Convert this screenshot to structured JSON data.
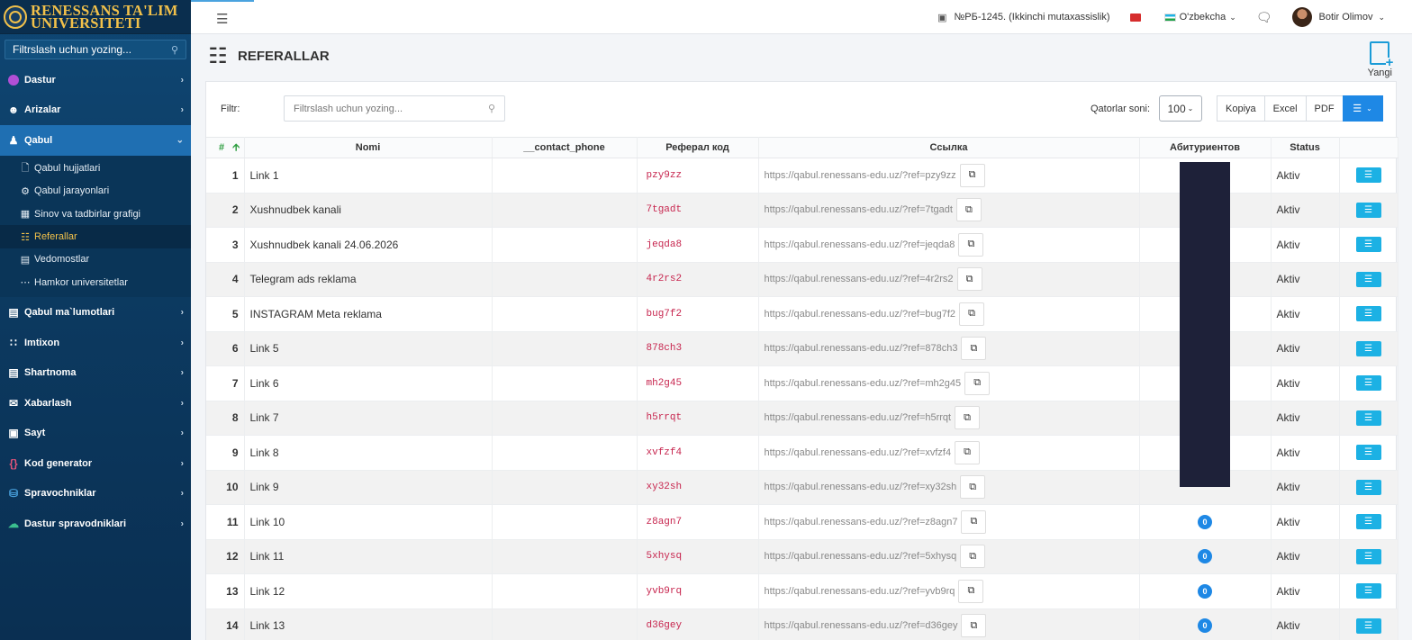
{
  "brand": {
    "line1": "RENESSANS TA'LIM",
    "line2": "UNIVERSITETI"
  },
  "sidebar": {
    "search_placeholder": "Filtrslash uchun yozing...",
    "items": [
      {
        "label": "Dastur",
        "icon": "info-circle-icon"
      },
      {
        "label": "Arizalar",
        "icon": "user-tie-icon"
      },
      {
        "label": "Qabul",
        "icon": "user-icon"
      },
      {
        "label": "Qabul ma`lumotlari",
        "icon": "clipboard-icon"
      },
      {
        "label": "Imtixon",
        "icon": "grid-dots-icon"
      },
      {
        "label": "Shartnoma",
        "icon": "document-icon"
      },
      {
        "label": "Xabarlash",
        "icon": "envelope-icon"
      },
      {
        "label": "Sayt",
        "icon": "window-icon"
      },
      {
        "label": "Kod generator",
        "icon": "code-braces-icon"
      },
      {
        "label": "Spravochniklar",
        "icon": "database-icon"
      },
      {
        "label": "Dastur spravodniklari",
        "icon": "cloud-icon"
      }
    ],
    "sub_items": [
      {
        "label": "Qabul hujjatlari",
        "icon": "file-icon"
      },
      {
        "label": "Qabul jarayonlari",
        "icon": "gear-icon"
      },
      {
        "label": "Sinov va tadbirlar grafigi",
        "icon": "calendar-icon"
      },
      {
        "label": "Referallar",
        "icon": "sitemap-icon"
      },
      {
        "label": "Vedomostlar",
        "icon": "list-icon"
      },
      {
        "label": "Hamkor universitetlar",
        "icon": "ellipsis-icon"
      }
    ]
  },
  "topbar": {
    "position": "№РБ-1245. (Ikkinchi mutaxassislik)",
    "language": "O'zbekcha",
    "user": "Botir Olimov"
  },
  "page": {
    "title": "REFERALLAR",
    "new_label": "Yangi"
  },
  "toolbar": {
    "filter_label": "Filtr:",
    "filter_placeholder": "Filtrslash uchun yozing...",
    "rows_label": "Qatorlar soni:",
    "rows_value": "100",
    "btn_copy": "Kopiya",
    "btn_excel": "Excel",
    "btn_pdf": "PDF"
  },
  "table": {
    "headers": {
      "num": "#",
      "name": "Nomi",
      "phone": "__contact_phone",
      "code": "Реферал код",
      "link": "Ссылка",
      "count": "Абитуриентов",
      "status": "Status"
    },
    "rows": [
      {
        "n": "1",
        "name": "Link 1",
        "code": "pzy9zz",
        "link": "https://qabul.renessans-edu.uz/?ref=pzy9zz",
        "count": "",
        "status": "Aktiv"
      },
      {
        "n": "2",
        "name": "Xushnudbek kanali",
        "code": "7tgadt",
        "link": "https://qabul.renessans-edu.uz/?ref=7tgadt",
        "count": "",
        "status": "Aktiv"
      },
      {
        "n": "3",
        "name": "Xushnudbek kanali 24.06.2026",
        "code": "jeqda8",
        "link": "https://qabul.renessans-edu.uz/?ref=jeqda8",
        "count": "",
        "status": "Aktiv"
      },
      {
        "n": "4",
        "name": "Telegram ads reklama",
        "code": "4r2rs2",
        "link": "https://qabul.renessans-edu.uz/?ref=4r2rs2",
        "count": "",
        "status": "Aktiv"
      },
      {
        "n": "5",
        "name": "INSTAGRAM Meta reklama",
        "code": "bug7f2",
        "link": "https://qabul.renessans-edu.uz/?ref=bug7f2",
        "count": "",
        "status": "Aktiv"
      },
      {
        "n": "6",
        "name": "Link 5",
        "code": "878ch3",
        "link": "https://qabul.renessans-edu.uz/?ref=878ch3",
        "count": "",
        "status": "Aktiv"
      },
      {
        "n": "7",
        "name": "Link 6",
        "code": "mh2g45",
        "link": "https://qabul.renessans-edu.uz/?ref=mh2g45",
        "count": "",
        "status": "Aktiv"
      },
      {
        "n": "8",
        "name": "Link 7",
        "code": "h5rrqt",
        "link": "https://qabul.renessans-edu.uz/?ref=h5rrqt",
        "count": "",
        "status": "Aktiv"
      },
      {
        "n": "9",
        "name": "Link 8",
        "code": "xvfzf4",
        "link": "https://qabul.renessans-edu.uz/?ref=xvfzf4",
        "count": "",
        "status": "Aktiv"
      },
      {
        "n": "10",
        "name": "Link 9",
        "code": "xy32sh",
        "link": "https://qabul.renessans-edu.uz/?ref=xy32sh",
        "count": "",
        "status": "Aktiv"
      },
      {
        "n": "11",
        "name": "Link 10",
        "code": "z8agn7",
        "link": "https://qabul.renessans-edu.uz/?ref=z8agn7",
        "count": "0",
        "status": "Aktiv"
      },
      {
        "n": "12",
        "name": "Link 11",
        "code": "5xhysq",
        "link": "https://qabul.renessans-edu.uz/?ref=5xhysq",
        "count": "0",
        "status": "Aktiv"
      },
      {
        "n": "13",
        "name": "Link 12",
        "code": "yvb9rq",
        "link": "https://qabul.renessans-edu.uz/?ref=yvb9rq",
        "count": "0",
        "status": "Aktiv"
      },
      {
        "n": "14",
        "name": "Link 13",
        "code": "d36gey",
        "link": "https://qabul.renessans-edu.uz/?ref=d36gey",
        "count": "0",
        "status": "Aktiv"
      }
    ]
  }
}
